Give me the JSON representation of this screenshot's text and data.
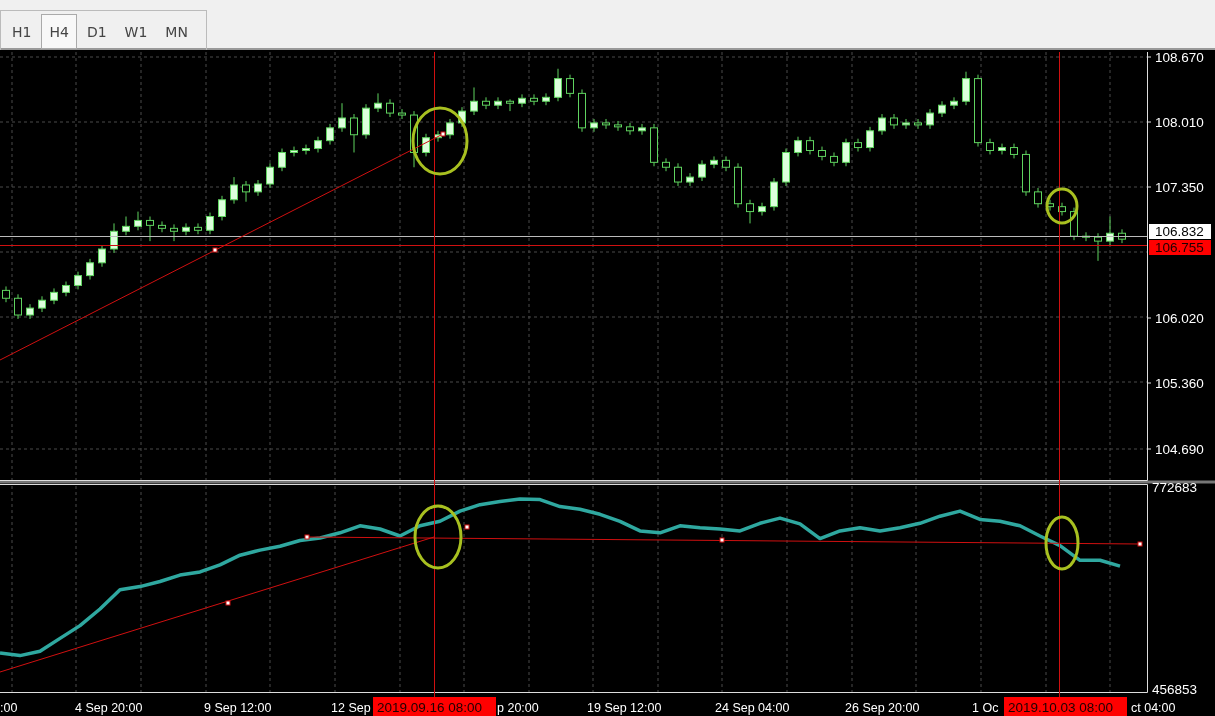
{
  "timeframes": [
    {
      "label": "H1",
      "selected": false
    },
    {
      "label": "H4",
      "selected": true
    },
    {
      "label": "D1",
      "selected": false
    },
    {
      "label": "W1",
      "selected": false
    },
    {
      "label": "MN",
      "selected": false
    }
  ],
  "price_chart": {
    "chart_data": {
      "type": "candlestick",
      "ohlc": [
        [
          106.3,
          106.34,
          106.18,
          106.22
        ],
        [
          106.22,
          106.26,
          106.01,
          106.05
        ],
        [
          106.05,
          106.16,
          106.01,
          106.12
        ],
        [
          106.12,
          106.24,
          106.08,
          106.2
        ],
        [
          106.2,
          106.32,
          106.16,
          106.28
        ],
        [
          106.28,
          106.39,
          106.24,
          106.35
        ],
        [
          106.35,
          106.49,
          106.31,
          106.45
        ],
        [
          106.45,
          106.62,
          106.41,
          106.58
        ],
        [
          106.58,
          106.76,
          106.54,
          106.72
        ],
        [
          106.72,
          106.98,
          106.68,
          106.9
        ],
        [
          106.9,
          107.05,
          106.86,
          106.95
        ],
        [
          106.95,
          107.1,
          106.91,
          107.01
        ],
        [
          107.01,
          107.05,
          106.8,
          106.96
        ],
        [
          106.96,
          107.0,
          106.89,
          106.93
        ],
        [
          106.93,
          106.97,
          106.8,
          106.9
        ],
        [
          106.9,
          106.98,
          106.86,
          106.94
        ],
        [
          106.94,
          106.98,
          106.87,
          106.91
        ],
        [
          106.91,
          107.09,
          106.87,
          107.05
        ],
        [
          107.05,
          107.26,
          107.01,
          107.22
        ],
        [
          107.22,
          107.45,
          107.18,
          107.37
        ],
        [
          107.37,
          107.41,
          107.2,
          107.3
        ],
        [
          107.3,
          107.42,
          107.26,
          107.38
        ],
        [
          107.38,
          107.59,
          107.34,
          107.55
        ],
        [
          107.55,
          107.74,
          107.51,
          107.7
        ],
        [
          107.7,
          107.76,
          107.66,
          107.72
        ],
        [
          107.72,
          107.78,
          107.68,
          107.74
        ],
        [
          107.74,
          107.86,
          107.7,
          107.82
        ],
        [
          107.82,
          107.99,
          107.78,
          107.95
        ],
        [
          107.95,
          108.2,
          107.91,
          108.05
        ],
        [
          108.05,
          108.09,
          107.7,
          107.88
        ],
        [
          107.88,
          108.19,
          107.84,
          108.15
        ],
        [
          108.15,
          108.3,
          108.11,
          108.2
        ],
        [
          108.2,
          108.24,
          108.06,
          108.1
        ],
        [
          108.1,
          108.14,
          108.04,
          108.08
        ],
        [
          108.08,
          108.12,
          107.55,
          107.7
        ],
        [
          107.7,
          107.89,
          107.66,
          107.85
        ],
        [
          107.85,
          107.92,
          107.81,
          107.88
        ],
        [
          107.88,
          108.04,
          107.84,
          108.0
        ],
        [
          108.0,
          108.16,
          107.96,
          108.12
        ],
        [
          108.12,
          108.36,
          108.08,
          108.22
        ],
        [
          108.22,
          108.26,
          108.14,
          108.18
        ],
        [
          108.18,
          108.26,
          108.14,
          108.22
        ],
        [
          108.22,
          108.24,
          108.12,
          108.2
        ],
        [
          108.2,
          108.29,
          108.16,
          108.25
        ],
        [
          108.25,
          108.29,
          108.18,
          108.22
        ],
        [
          108.22,
          108.3,
          108.18,
          108.26
        ],
        [
          108.26,
          108.55,
          108.22,
          108.45
        ],
        [
          108.45,
          108.49,
          108.26,
          108.3
        ],
        [
          108.3,
          108.34,
          107.91,
          107.95
        ],
        [
          107.95,
          108.04,
          107.91,
          108.0
        ],
        [
          108.0,
          108.04,
          107.94,
          107.98
        ],
        [
          107.98,
          108.02,
          107.92,
          107.96
        ],
        [
          107.96,
          108.0,
          107.88,
          107.92
        ],
        [
          107.92,
          107.99,
          107.88,
          107.95
        ],
        [
          107.95,
          107.99,
          107.56,
          107.6
        ],
        [
          107.6,
          107.64,
          107.51,
          107.55
        ],
        [
          107.55,
          107.59,
          107.36,
          107.4
        ],
        [
          107.4,
          107.49,
          107.36,
          107.45
        ],
        [
          107.45,
          107.62,
          107.41,
          107.58
        ],
        [
          107.58,
          107.66,
          107.54,
          107.62
        ],
        [
          107.62,
          107.66,
          107.51,
          107.55
        ],
        [
          107.55,
          107.59,
          107.14,
          107.18
        ],
        [
          107.18,
          107.22,
          106.98,
          107.1
        ],
        [
          107.1,
          107.19,
          107.06,
          107.15
        ],
        [
          107.15,
          107.44,
          107.11,
          107.4
        ],
        [
          107.4,
          107.74,
          107.36,
          107.7
        ],
        [
          107.7,
          107.86,
          107.66,
          107.82
        ],
        [
          107.82,
          107.86,
          107.68,
          107.72
        ],
        [
          107.72,
          107.76,
          107.62,
          107.66
        ],
        [
          107.66,
          107.7,
          107.56,
          107.6
        ],
        [
          107.6,
          107.84,
          107.56,
          107.8
        ],
        [
          107.8,
          107.84,
          107.71,
          107.75
        ],
        [
          107.75,
          107.96,
          107.71,
          107.92
        ],
        [
          107.92,
          108.09,
          107.88,
          108.05
        ],
        [
          108.05,
          108.09,
          107.94,
          107.98
        ],
        [
          107.98,
          108.04,
          107.94,
          108.0
        ],
        [
          108.0,
          108.04,
          107.94,
          107.98
        ],
        [
          107.98,
          108.14,
          107.94,
          108.1
        ],
        [
          108.1,
          108.22,
          108.06,
          108.18
        ],
        [
          108.18,
          108.26,
          108.14,
          108.22
        ],
        [
          108.22,
          108.52,
          108.18,
          108.45
        ],
        [
          108.45,
          108.49,
          107.76,
          107.8
        ],
        [
          107.8,
          107.84,
          107.68,
          107.72
        ],
        [
          107.72,
          107.79,
          107.68,
          107.75
        ],
        [
          107.75,
          107.79,
          107.64,
          107.68
        ],
        [
          107.68,
          107.72,
          107.26,
          107.3
        ],
        [
          107.3,
          107.34,
          107.14,
          107.18
        ],
        [
          107.18,
          107.22,
          107.11,
          107.15
        ],
        [
          107.15,
          107.19,
          107.06,
          107.1
        ],
        [
          107.1,
          107.14,
          106.81,
          106.85
        ],
        [
          106.85,
          106.89,
          106.8,
          106.84
        ],
        [
          106.84,
          106.88,
          106.6,
          106.8
        ],
        [
          106.8,
          107.05,
          106.76,
          106.88
        ],
        [
          106.88,
          106.92,
          106.78,
          106.82
        ]
      ],
      "ylim": [
        104.37,
        108.72
      ],
      "yticks": [
        {
          "value": 108.67,
          "label": "108.670"
        },
        {
          "value": 108.01,
          "label": "108.010"
        },
        {
          "value": 107.35,
          "label": "107.350"
        },
        {
          "value": 106.02,
          "label": "106.020"
        },
        {
          "value": 105.36,
          "label": "105.360"
        },
        {
          "value": 104.69,
          "label": "104.690"
        }
      ]
    },
    "bid_label": "106.832",
    "line_label": "106.755"
  },
  "indicator_chart": {
    "chart_data": {
      "type": "line",
      "series": [
        {
          "color": "#2fa8a0",
          "values": [
            513000,
            509000,
            516000,
            536000,
            556000,
            582000,
            612000,
            617000,
            625000,
            635000,
            640000,
            651000,
            666000,
            674000,
            680000,
            689000,
            693000,
            701000,
            712000,
            707000,
            696000,
            712000,
            719000,
            735000,
            745000,
            750000,
            754000,
            753000,
            742000,
            738000,
            730000,
            719000,
            704000,
            701000,
            712000,
            709000,
            707000,
            704000,
            716000,
            724000,
            715000,
            692000,
            704000,
            709000,
            704000,
            709000,
            716000,
            727000,
            735000,
            722000,
            719000,
            712000,
            696000,
            681000,
            658000,
            658000,
            649000
          ]
        }
      ],
      "ylim": [
        456853,
        772683
      ],
      "yticks": [
        {
          "value": 772683,
          "label": "772683"
        },
        {
          "value": 456853,
          "label": "456853"
        }
      ]
    }
  },
  "time_axis": {
    "labels": [
      ":00",
      "4 Sep 20:00",
      "9 Sep 12:00",
      "12 Sep",
      "p 20:00",
      "19 Sep 12:00",
      "24 Sep 04:00",
      "26 Sep 20:00",
      "1 Oc",
      "ct 04:00"
    ],
    "crosshair_labels": [
      "2019.09.16 08:00",
      "2019.10.03 08:00"
    ]
  }
}
